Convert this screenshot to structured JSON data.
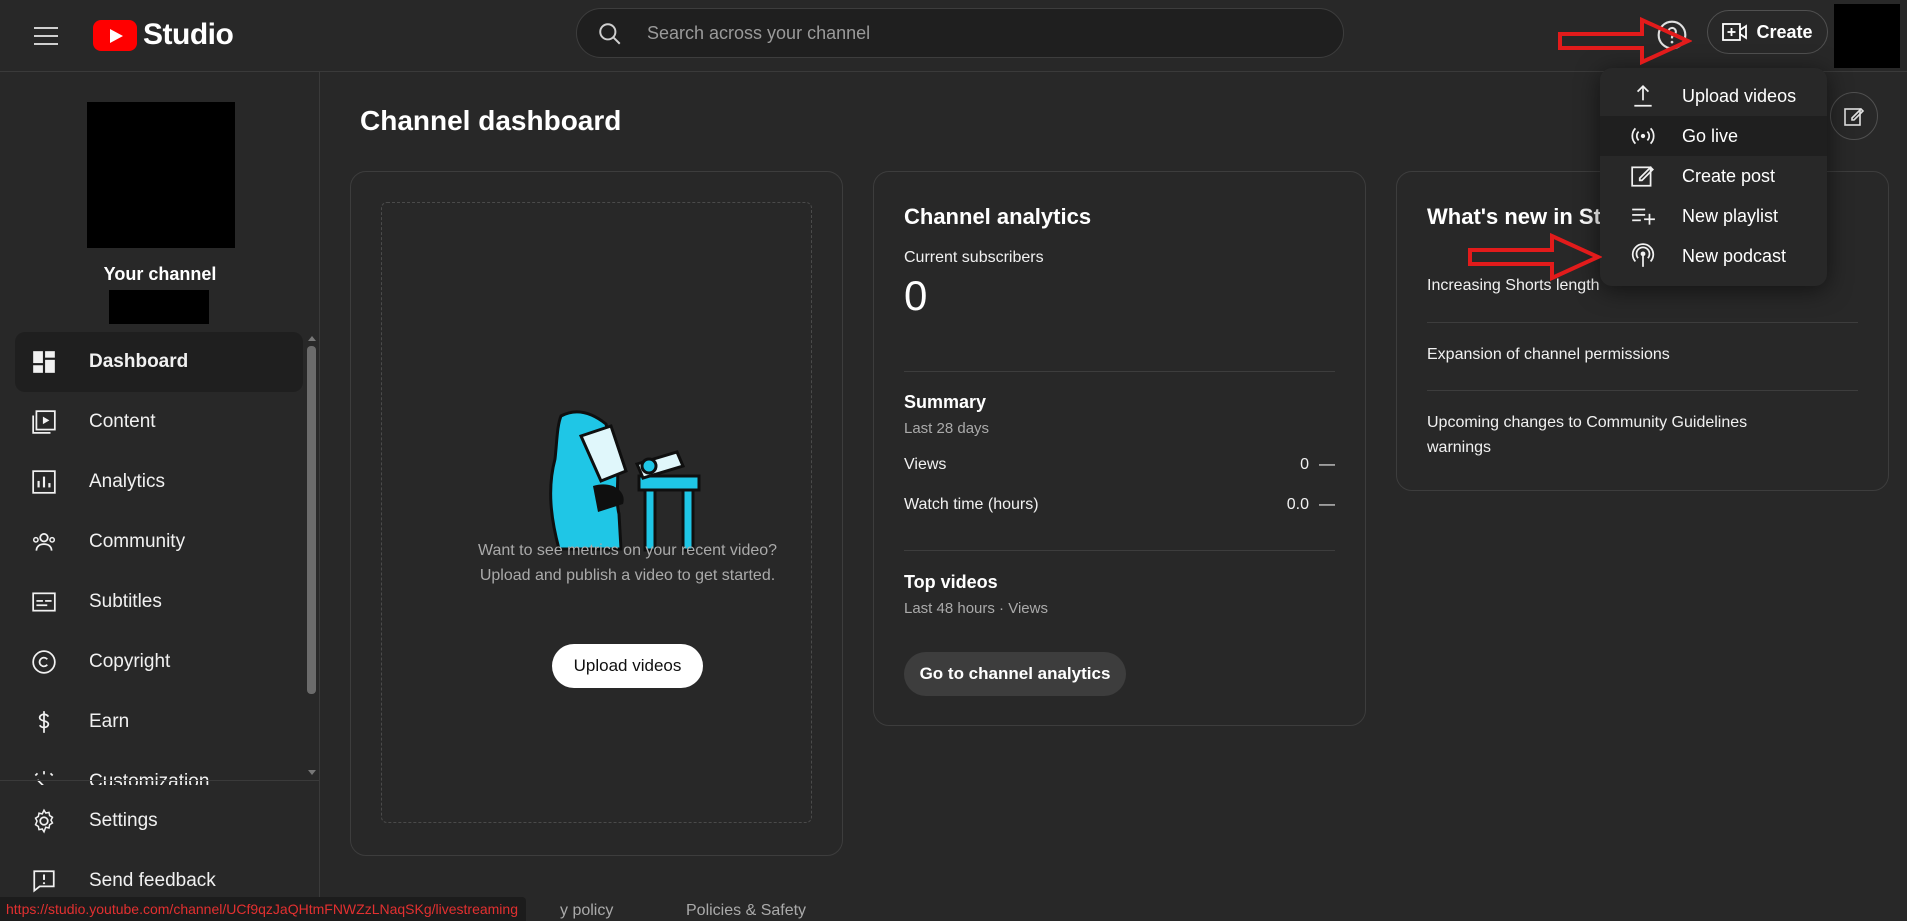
{
  "app": {
    "logo_text": "Studio"
  },
  "search": {
    "placeholder": "Search across your channel"
  },
  "header": {
    "create_label": "Create"
  },
  "sidebar": {
    "your_channel": "Your channel",
    "items": [
      {
        "label": "Dashboard",
        "icon": "dashboard-icon"
      },
      {
        "label": "Content",
        "icon": "content-icon"
      },
      {
        "label": "Analytics",
        "icon": "analytics-icon"
      },
      {
        "label": "Community",
        "icon": "community-icon"
      },
      {
        "label": "Subtitles",
        "icon": "subtitles-icon"
      },
      {
        "label": "Copyright",
        "icon": "copyright-icon"
      },
      {
        "label": "Earn",
        "icon": "earn-icon"
      },
      {
        "label": "Customization",
        "icon": "customization-icon"
      }
    ],
    "bottom": [
      {
        "label": "Settings",
        "icon": "gear-icon"
      },
      {
        "label": "Send feedback",
        "icon": "feedback-icon"
      }
    ]
  },
  "main": {
    "title": "Channel dashboard",
    "upload_card": {
      "line1": "Want to see metrics on your recent video?",
      "line2": "Upload and publish a video to get started.",
      "button": "Upload videos"
    },
    "analytics_card": {
      "title": "Channel analytics",
      "subs_label": "Current subscribers",
      "subs_value": "0",
      "summary_title": "Summary",
      "summary_period": "Last 28 days",
      "rows": [
        {
          "label": "Views",
          "value": "0",
          "trend": "—"
        },
        {
          "label": "Watch time (hours)",
          "value": "0.0",
          "trend": "—"
        }
      ],
      "top_title": "Top videos",
      "top_period": "Last 48 hours · Views",
      "button": "Go to channel analytics"
    },
    "news_card": {
      "title": "What's new in Studio",
      "items": [
        "Increasing Shorts length",
        "Expansion of channel permissions",
        "Upcoming changes to Community Guidelines warnings"
      ]
    }
  },
  "dropdown": {
    "items": [
      {
        "label": "Upload videos",
        "icon": "upload-icon"
      },
      {
        "label": "Go live",
        "icon": "live-icon"
      },
      {
        "label": "Create post",
        "icon": "edit-icon"
      },
      {
        "label": "New playlist",
        "icon": "playlist-add-icon"
      },
      {
        "label": "New podcast",
        "icon": "podcast-icon"
      }
    ]
  },
  "footer": {
    "privacy": "y policy",
    "policies": "Policies & Safety"
  },
  "status_url": "https://studio.youtube.com/channel/UCf9qzJaQHtmFNWZzLNaqSKg/livestreaming",
  "colors": {
    "brand_red": "#ff0000",
    "annotation_red": "#e21b1b",
    "background": "#282828"
  }
}
